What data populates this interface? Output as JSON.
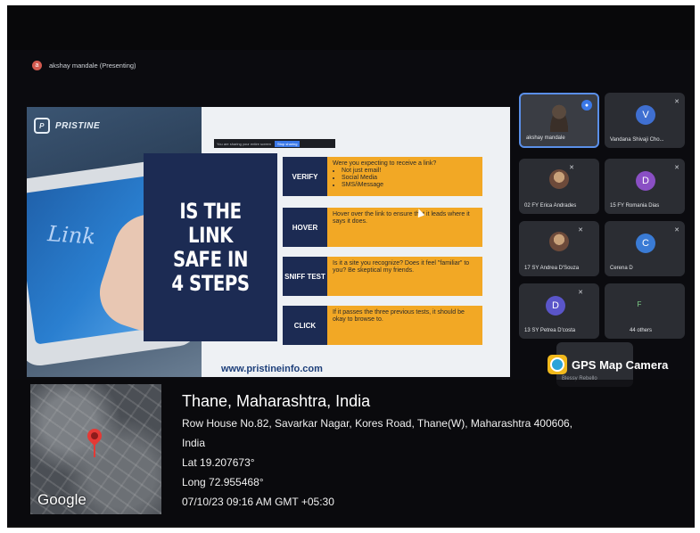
{
  "meeting": {
    "presenter_initial": "a",
    "presenter_label": "akshay mandale (Presenting)"
  },
  "slide": {
    "logo": "PRISTINE",
    "headline": "IS THE LINK SAFE IN 4 STEPS",
    "screen_share_note": "You are sharing your entire screen",
    "screen_share_stop": "Stop sharing",
    "tablet_word": "Link",
    "steps": [
      {
        "label": "VERIFY",
        "text": "Were you expecting to receive a link?",
        "bullets": [
          "Not just email!",
          "Social Media",
          "SMS/iMessage"
        ]
      },
      {
        "label": "HOVER",
        "text": "Hover over the link to ensure that it leads where it says it does.",
        "bullets": []
      },
      {
        "label": "SNIFF TEST",
        "text": "Is it a site you recognize? Does it feel \"familiar\" to you? Be skeptical my friends.",
        "bullets": []
      },
      {
        "label": "CLICK",
        "text": "If it passes the three previous tests, it should be okay to browse to.",
        "bullets": []
      }
    ],
    "url": "www.pristineinfo.com"
  },
  "participants": [
    {
      "name": "akshay mandale",
      "type": "video",
      "active": true
    },
    {
      "name": "Vandana Shivaji Cho...",
      "initial": "V",
      "color": "#3f6fd1"
    },
    {
      "name": "02 FY Erica Andrades",
      "type": "photo"
    },
    {
      "name": "15 FY Romania Dias",
      "initial": "D",
      "color": "#8a4fc4"
    },
    {
      "name": "17 SY Andrea D'Souza",
      "type": "photo"
    },
    {
      "name": "Cerena D",
      "initial": "C",
      "color": "#3a7bd5"
    },
    {
      "name": "13 SY Petrea D'costa",
      "initial": "D",
      "color": "#5a55c9"
    },
    {
      "name": "44 others",
      "initial": "F",
      "color": "#3a8a4a"
    },
    {
      "name": "Blessy Rebello",
      "type": "photo"
    }
  ],
  "gps": {
    "brand": "GPS Map Camera",
    "map_provider": "Google",
    "city": "Thane, Maharashtra, India",
    "address_line1": "Row House No.82, Savarkar Nagar, Kores Road, Thane(W), Maharashtra 400606,",
    "address_line2": "India",
    "lat": "Lat 19.207673°",
    "long": "Long 72.955468°",
    "datetime": "07/10/23 09:16 AM GMT +05:30"
  },
  "colors": {
    "navy": "#1c2b53",
    "orange": "#f2a825",
    "speaker_blue": "#3b78e7",
    "pin_red": "#e53935",
    "gps_yellow": "#f1b91c"
  },
  "icons": [
    "presenter-avatar-icon",
    "mic-muted-icon",
    "speaker-active-icon",
    "map-pin-icon",
    "gps-map-camera-icon",
    "cursor-icon"
  ]
}
